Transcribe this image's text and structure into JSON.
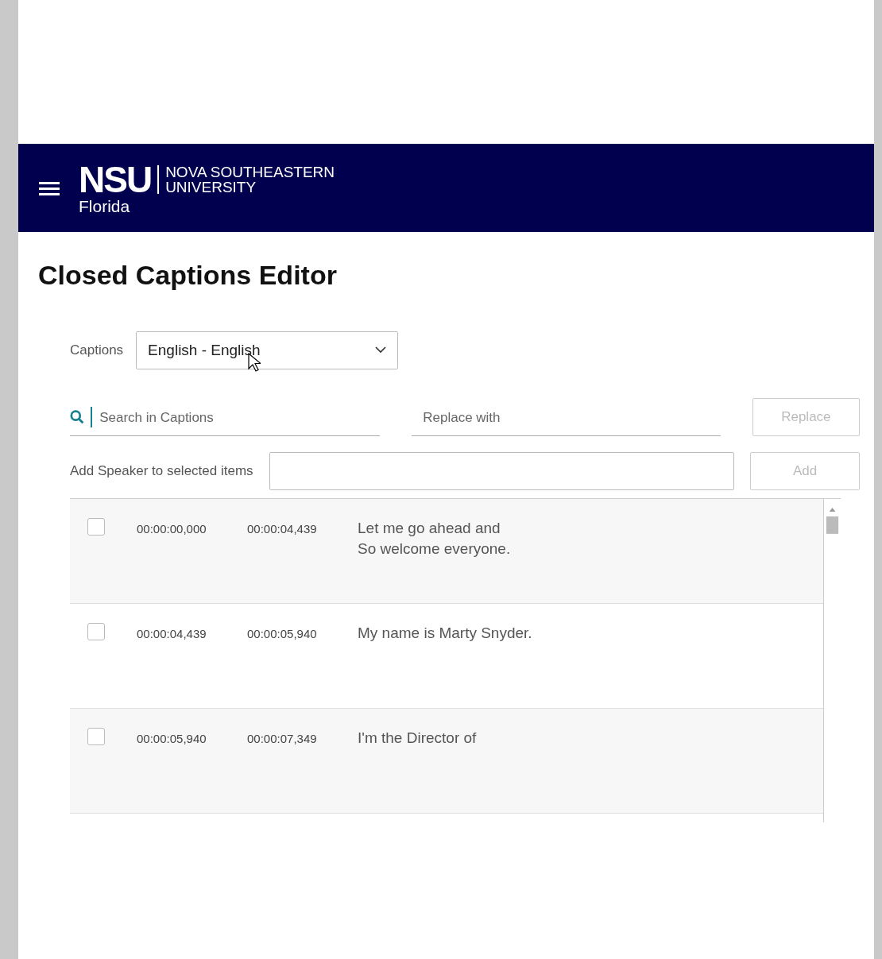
{
  "header": {
    "logo": {
      "mark": "NSU",
      "name_lines": [
        "NOVA SOUTHEASTERN",
        "UNIVERSITY"
      ],
      "sub": "Florida"
    }
  },
  "title": "Closed Captions Editor",
  "captions": {
    "label": "Captions",
    "value": "English - English"
  },
  "search": {
    "placeholder": "Search in Captions"
  },
  "replace": {
    "placeholder": "Replace with",
    "button": {
      "label": "Replace",
      "disabled": true
    }
  },
  "speaker": {
    "label": "Add Speaker to selected items",
    "button": {
      "label": "Add",
      "disabled": true
    }
  },
  "rows": [
    {
      "checked": false,
      "start": "00:00:00,000",
      "end": "00:00:04,439",
      "lines": [
        "Let me go ahead and",
        "So welcome everyone."
      ]
    },
    {
      "checked": false,
      "start": "00:00:04,439",
      "end": "00:00:05,940",
      "lines": [
        "My name is Marty Snyder."
      ]
    },
    {
      "checked": false,
      "start": "00:00:05,940",
      "end": "00:00:07,349",
      "lines": [
        "I'm the Director of"
      ]
    }
  ]
}
